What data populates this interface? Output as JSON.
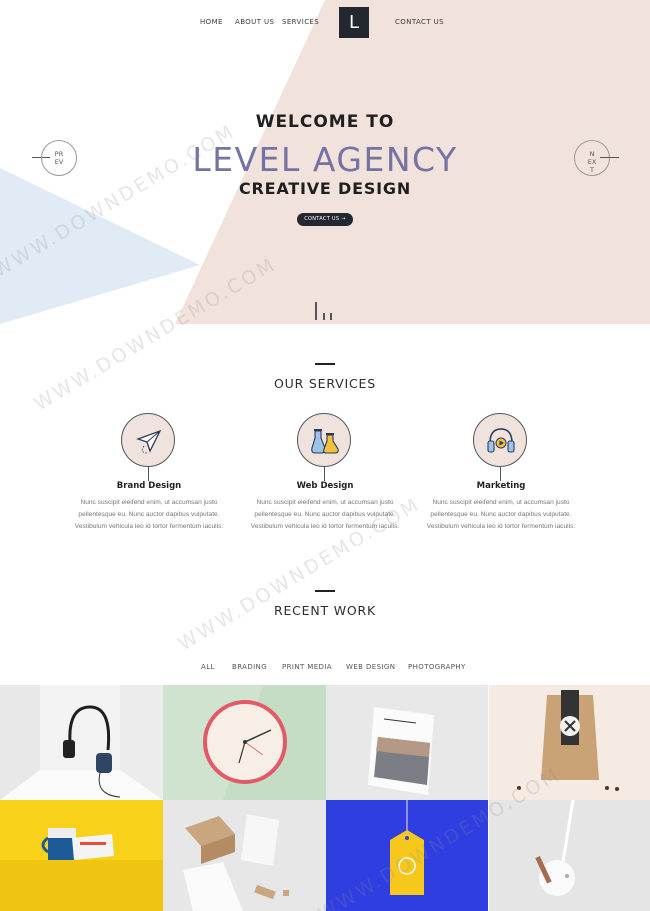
{
  "nav": {
    "items": [
      "HOME",
      "ABOUT US",
      "SERVICES",
      "CONTACT US"
    ],
    "logo": "L"
  },
  "hero": {
    "line1": "WELCOME TO",
    "line2": "LEVEL AGENCY",
    "line3": "CREATIVE DESIGN",
    "button": "CONTACT US →",
    "prev": [
      "PR",
      "EV"
    ],
    "next": [
      "N",
      "EX",
      "T"
    ]
  },
  "services": {
    "title": "OUR SERVICES",
    "items": [
      {
        "title": "Brand Design",
        "text": "Nunc suscipit eleifend enim, ut accumsan justo pellentesque eu. Nunc auctor dapibus vulputate. Vestibulum vehicula leo id tortor fermentum iaculis.",
        "icon": "paper-plane-icon"
      },
      {
        "title": "Web Design",
        "text": "Nunc suscipit eleifend enim, ut accumsan justo pellentesque eu. Nunc auctor dapibus vulputate. Vestibulum vehicula leo id tortor fermentum iaculis.",
        "icon": "flask-icon"
      },
      {
        "title": "Marketing",
        "text": "Nunc suscipit eleifend enim, ut accumsan justo pellentesque eu. Nunc auctor dapibus vulputate. Vestibulum vehicula leo id tortor fermentum iaculis.",
        "icon": "headphones-icon"
      }
    ]
  },
  "work": {
    "title": "RECENT WORK",
    "filters": [
      "ALL",
      "BRADING",
      "PRINT MEDIA",
      "WEB DESIGN",
      "PHOTOGRAPHY"
    ]
  },
  "watermark": "WWW.DOWNDEMO.COM",
  "colors": {
    "accent": "#7474a4",
    "dark": "#23272f",
    "pink": "#f0e2dd",
    "blue": "#e1ebf5"
  }
}
